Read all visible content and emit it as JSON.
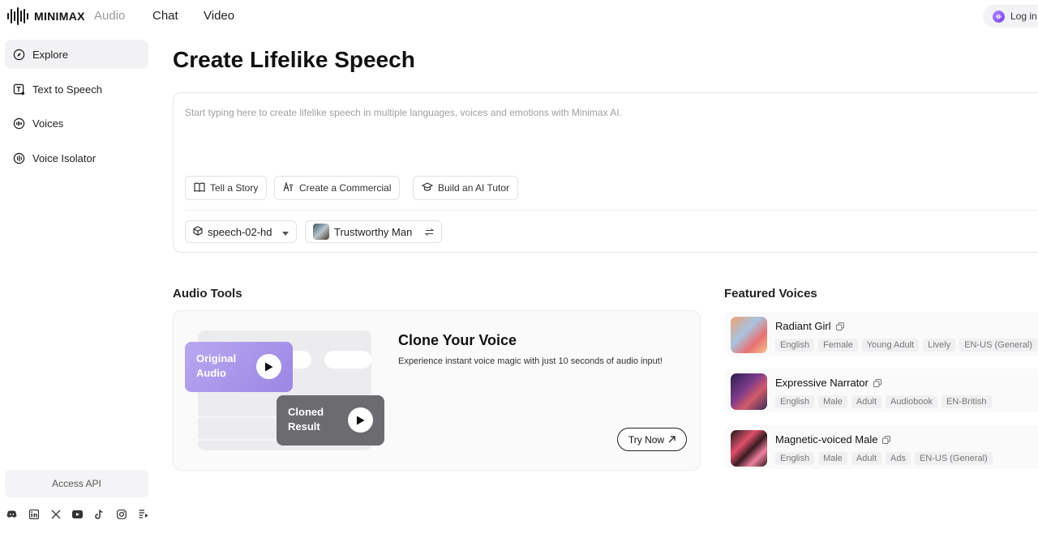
{
  "app": {
    "logo_text": "MINIMAX",
    "nav": [
      "Audio",
      "Chat",
      "Video"
    ],
    "login_label": "Log in"
  },
  "sidebar": {
    "items": [
      {
        "label": "Explore",
        "icon": "compass-icon",
        "active": true
      },
      {
        "label": "Text to Speech",
        "icon": "text-to-speech-icon",
        "active": false
      },
      {
        "label": "Voices",
        "icon": "voices-icon",
        "active": false
      },
      {
        "label": "Voice Isolator",
        "icon": "voice-isolator-icon",
        "active": false
      }
    ],
    "access_api_label": "Access API",
    "socials": [
      "discord-icon",
      "linkedin-icon",
      "x-icon",
      "youtube-icon",
      "tiktok-icon",
      "instagram-icon",
      "feed-icon"
    ]
  },
  "main": {
    "title": "Create Lifelike Speech",
    "editor": {
      "placeholder": "Start typing here to create lifelike speech in multiple languages, voices and emotions with Minimax AI.",
      "prompts": [
        "Tell a Story",
        "Create a Commercial",
        "Build an AI Tutor"
      ],
      "model": "speech-02-hd",
      "voice": "Trustworthy Man"
    },
    "audio_tools": {
      "heading": "Audio Tools",
      "original_label": "Original Audio",
      "cloned_label": "Cloned Result",
      "title": "Clone Your Voice",
      "description": "Experience instant voice magic with just 10 seconds of audio input!",
      "cta": "Try Now"
    },
    "featured_voices": {
      "heading": "Featured Voices",
      "voices": [
        {
          "name": "Radiant Girl",
          "tags": [
            "English",
            "Female",
            "Young Adult",
            "Lively",
            "EN-US (General)"
          ]
        },
        {
          "name": "Expressive Narrator",
          "tags": [
            "English",
            "Male",
            "Adult",
            "Audiobook",
            "EN-British"
          ]
        },
        {
          "name": "Magnetic-voiced Male",
          "tags": [
            "English",
            "Male",
            "Adult",
            "Ads",
            "EN-US (General)"
          ]
        }
      ]
    }
  },
  "colors": {
    "accent": "#9b86e4",
    "cloned_card": "#6b6b70"
  }
}
